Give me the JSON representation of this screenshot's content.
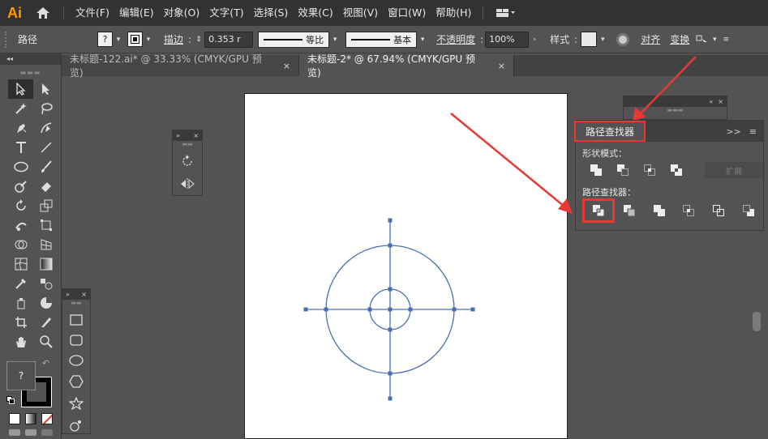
{
  "app": {
    "logo": "Ai"
  },
  "menu": [
    "文件(F)",
    "编辑(E)",
    "对象(O)",
    "文字(T)",
    "选择(S)",
    "效果(C)",
    "视图(V)",
    "窗口(W)",
    "帮助(H)"
  ],
  "control": {
    "selection_label": "路径",
    "fill_value": "?",
    "stroke_label": "描边",
    "stroke_weight": "0.353 r",
    "profile_label": "等比",
    "brush_label": "基本",
    "opacity_label": "不透明度",
    "opacity_value": "100%",
    "style_label": "样式",
    "align_label": "对齐",
    "transform_label": "变换"
  },
  "tabs": [
    {
      "label": "未标题-122.ai* @ 33.33% (CMYK/GPU 预览)",
      "close": "×",
      "active": false
    },
    {
      "label": "未标题-2* @ 67.94% (CMYK/GPU 预览)",
      "close": "×",
      "active": true
    }
  ],
  "toolbar": {
    "grip": "◂◂",
    "fill_stroke_label": "?"
  },
  "pathfinder": {
    "title": "路径查找器",
    "shape_modes_label": "形状模式：",
    "pathfinders_label": "路径查找器：",
    "expand_label": "扩展",
    "collapse_icon": ">>"
  },
  "colors": {
    "accent": "#e53935",
    "path_stroke": "#4a6fb1",
    "anchor": "#4a6fb1",
    "ai_orange": "#ff9a00"
  }
}
